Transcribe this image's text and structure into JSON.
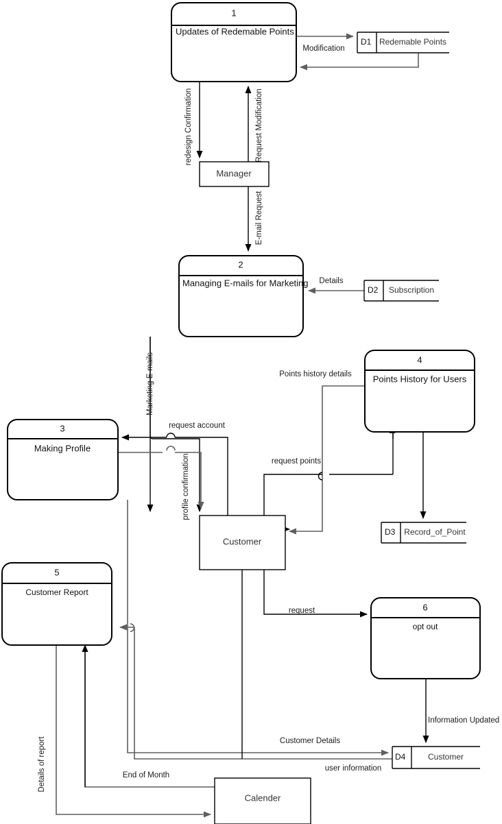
{
  "diagram": {
    "type": "data-flow-diagram",
    "title": "",
    "processes": [
      {
        "id": "1",
        "number": "1",
        "name": "Updates of Redemable Points"
      },
      {
        "id": "2",
        "number": "2",
        "name": "Managing E-mails for Marketing"
      },
      {
        "id": "3",
        "number": "3",
        "name": "Making Profile"
      },
      {
        "id": "4",
        "number": "4",
        "name": "Points History for Users"
      },
      {
        "id": "5",
        "number": "5",
        "name": "Customer Report"
      },
      {
        "id": "6",
        "number": "6",
        "name": "opt out"
      }
    ],
    "entities": [
      {
        "id": "manager",
        "name": "Manager"
      },
      {
        "id": "customer",
        "name": "Customer"
      },
      {
        "id": "calender",
        "name": "Calender"
      }
    ],
    "datastores": [
      {
        "id": "D1",
        "code": "D1",
        "name": "Redemable Points"
      },
      {
        "id": "D2",
        "code": "D2",
        "name": "Subscription"
      },
      {
        "id": "D3",
        "code": "D3",
        "name": "Record_of_Point"
      },
      {
        "id": "D4",
        "code": "D4",
        "name": "Customer"
      }
    ],
    "flows": [
      {
        "id": "f1",
        "label": "Modification",
        "from": "1",
        "to": "D1"
      },
      {
        "id": "f2",
        "label": "redesign Confirmation",
        "from": "1",
        "to": "manager"
      },
      {
        "id": "f3",
        "label": "Request Modification",
        "from": "manager",
        "to": "1"
      },
      {
        "id": "f4",
        "label": "E-mail Request",
        "from": "manager",
        "to": "2"
      },
      {
        "id": "f5",
        "label": "Details",
        "from": "D2",
        "to": "2"
      },
      {
        "id": "f6",
        "label": "Marketing E-mails",
        "from": "2",
        "to": "customer"
      },
      {
        "id": "f7",
        "label": "Points history details",
        "from": "4",
        "to": "customer"
      },
      {
        "id": "f8",
        "label": "request account",
        "from": "customer",
        "to": "3"
      },
      {
        "id": "f9",
        "label": "profile confirmation",
        "from": "3",
        "to": "customer"
      },
      {
        "id": "f10",
        "label": "request points",
        "from": "customer",
        "to": "4"
      },
      {
        "id": "f11",
        "label": "request",
        "from": "customer",
        "to": "6"
      },
      {
        "id": "f12",
        "label": "Information Updated",
        "from": "6",
        "to": "D4"
      },
      {
        "id": "f13",
        "label": "Customer Details",
        "from": "3",
        "to": "D4"
      },
      {
        "id": "f14",
        "label": "user information",
        "from": "D4",
        "to": "5"
      },
      {
        "id": "f15",
        "label": "End of Month",
        "from": "5",
        "to": "calender"
      },
      {
        "id": "f16",
        "label": "Details of report",
        "from": "5",
        "to": "calender"
      }
    ],
    "colors": {
      "background": "#ffffff",
      "stroke": "#000000",
      "flow": "#5f5f5f",
      "text": "#111111"
    }
  }
}
